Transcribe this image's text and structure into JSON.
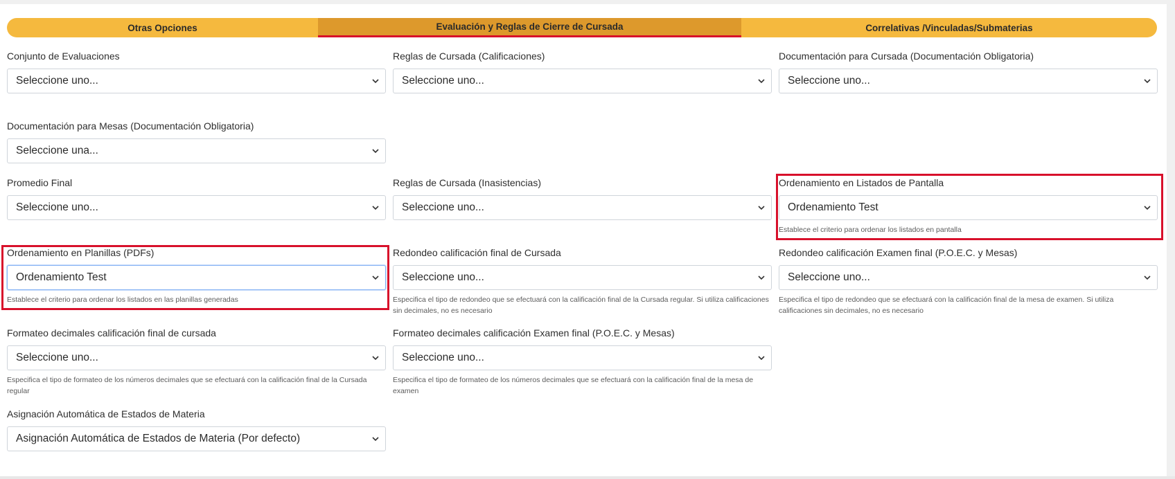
{
  "tabs": [
    {
      "label": "Otras Opciones"
    },
    {
      "label": "Evaluación y Reglas de Cierre de Cursada"
    },
    {
      "label": "Correlativas /Vinculadas/Submaterias"
    }
  ],
  "fields": {
    "conjunto_evaluaciones": {
      "label": "Conjunto de Evaluaciones",
      "value": "Seleccione uno..."
    },
    "reglas_calificaciones": {
      "label": "Reglas de Cursada (Calificaciones)",
      "value": "Seleccione uno..."
    },
    "doc_cursada": {
      "label": "Documentación para Cursada (Documentación Obligatoria)",
      "value": "Seleccione uno..."
    },
    "doc_mesas": {
      "label": "Documentación para Mesas (Documentación Obligatoria)",
      "value": "Seleccione una..."
    },
    "promedio_final": {
      "label": "Promedio Final",
      "value": "Seleccione uno..."
    },
    "reglas_inasistencias": {
      "label": "Reglas de Cursada (Inasistencias)",
      "value": "Seleccione uno..."
    },
    "orden_pantalla": {
      "label": "Ordenamiento en Listados de Pantalla",
      "value": "Ordenamiento Test",
      "help": "Establece el criterio para ordenar los listados en pantalla"
    },
    "orden_planillas": {
      "label": "Ordenamiento en Planillas (PDFs)",
      "value": "Ordenamiento Test",
      "help": "Establece el criterio para ordenar los listados en las planillas generadas"
    },
    "redondeo_cursada": {
      "label": "Redondeo calificación final de Cursada",
      "value": "Seleccione uno...",
      "help": "Especifica el tipo de redondeo que se efectuará con la calificación final de la Cursada regular. Si utiliza calificaciones sin decimales, no es necesario"
    },
    "redondeo_examen": {
      "label": "Redondeo calificación Examen final (P.O.E.C. y Mesas)",
      "value": "Seleccione uno...",
      "help": "Especifica el tipo de redondeo que se efectuará con la calificación final de la mesa de examen. Si utiliza calificaciones sin decimales, no es necesario"
    },
    "formateo_cursada": {
      "label": "Formateo decimales calificación final de cursada",
      "value": "Seleccione uno...",
      "help": "Especifica el tipo de formateo de los números decimales que se efectuará con la calificación final de la Cursada regular"
    },
    "formateo_examen": {
      "label": "Formateo decimales calificación Examen final (P.O.E.C. y Mesas)",
      "value": "Seleccione uno...",
      "help": "Especifica el tipo de formateo de los números decimales que se efectuará con la calificación final de la mesa de examen"
    },
    "asignacion_estados": {
      "label": "Asignación Automática de Estados de Materia",
      "value": "Asignación Automática de Estados de Materia (Por defecto)"
    }
  },
  "colors": {
    "tab_bar": "#f5b93e",
    "tab_active": "#dd992c",
    "highlight": "#d8102b"
  },
  "icons": {
    "select_arrow": "chevron-down-icon"
  }
}
